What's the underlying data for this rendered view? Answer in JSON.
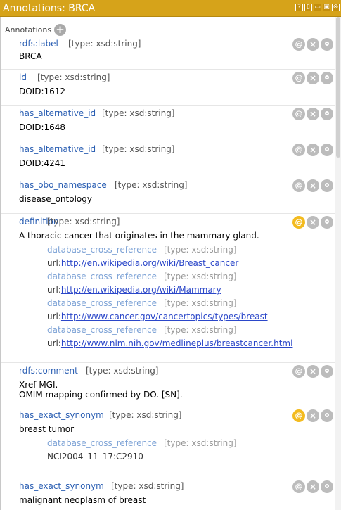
{
  "window": {
    "title": "Annotations: BRCA"
  },
  "header": {
    "label": "Annotations"
  },
  "rows": [
    {
      "prop": "rdfs:label",
      "type": "[type: xsd:string]",
      "lines": [
        "BRCA"
      ]
    },
    {
      "prop": "id",
      "type": "[type: xsd:string]",
      "lines": [
        "DOID:1612"
      ]
    },
    {
      "prop": "has_alternative_id",
      "type": "[type: xsd:string]",
      "lines": [
        "DOID:1648"
      ]
    },
    {
      "prop": "has_alternative_id",
      "type": "[type: xsd:string]",
      "lines": [
        "DOID:4241"
      ]
    },
    {
      "prop": "has_obo_namespace",
      "type": "[type: xsd:string]",
      "lines": [
        "disease_ontology"
      ]
    },
    {
      "prop": "definition",
      "type": "[type: xsd:string]",
      "lines": [
        "A thoracic cancer that originates in the mammary gland."
      ],
      "subs": [
        {
          "prop": "database_cross_reference",
          "type": "[type: xsd:string]",
          "prefix": "url:",
          "link": "http://en.wikipedia.org/wiki/Breast_cancer"
        },
        {
          "prop": "database_cross_reference",
          "type": "[type: xsd:string]",
          "prefix": "url:",
          "link": "http://en.wikipedia.org/wiki/Mammary"
        },
        {
          "prop": "database_cross_reference",
          "type": "[type: xsd:string]",
          "prefix": "url:",
          "link": "http://www.cancer.gov/cancertopics/types/breast"
        },
        {
          "prop": "database_cross_reference",
          "type": "[type: xsd:string]",
          "prefix": "url:",
          "link": "http://www.nlm.nih.gov/medlineplus/breastcancer.html"
        }
      ]
    },
    {
      "prop": "rdfs:comment",
      "type": "[type: xsd:string]",
      "lines": [
        "Xref MGI.",
        "OMIM mapping confirmed by DO. [SN]."
      ]
    },
    {
      "prop": "has_exact_synonym",
      "type": "[type: xsd:string]",
      "lines": [
        "breast tumor"
      ],
      "subs": [
        {
          "prop": "database_cross_reference",
          "type": "[type: xsd:string]",
          "prefix": "NCI2004_11_17:C2910",
          "link": ""
        }
      ]
    },
    {
      "prop": "has_exact_synonym",
      "type": "[type: xsd:string]",
      "lines": [
        "malignant neoplasm of breast"
      ]
    }
  ],
  "actions": {
    "annotate": "@",
    "delete": "×",
    "edit": ""
  },
  "window_buttons": [
    "?",
    "▯",
    "▭",
    "▣",
    "⊗"
  ]
}
